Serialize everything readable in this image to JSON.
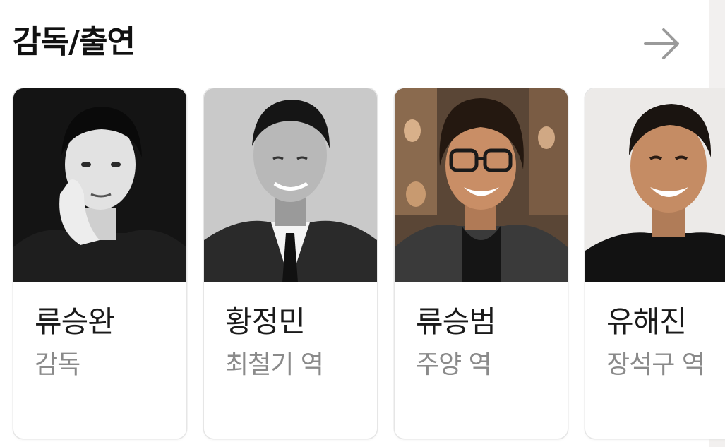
{
  "section": {
    "title": "감독/출연",
    "more_icon": "arrow-right-icon"
  },
  "cast": [
    {
      "name": "류승완",
      "role": "감독"
    },
    {
      "name": "황정민",
      "role": "최철기 역"
    },
    {
      "name": "류승범",
      "role": "주양 역"
    },
    {
      "name": "유해진",
      "role": "장석구 역"
    }
  ],
  "colors": {
    "title": "#111111",
    "name": "#1a1a1a",
    "role": "#8a8a8a",
    "arrow": "#9a9a9a",
    "card_border": "#e6e6e6"
  }
}
